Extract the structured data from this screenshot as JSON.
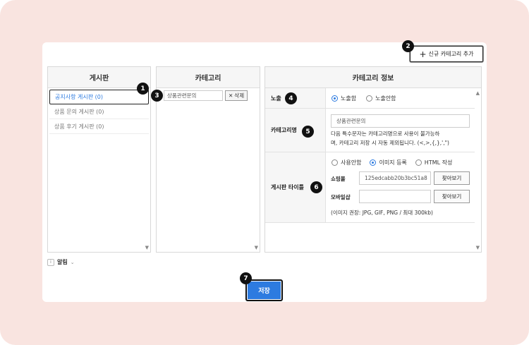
{
  "toolbar": {
    "add_category_label": "신규 카테고리 추가"
  },
  "board_panel": {
    "title": "게시판",
    "items": [
      {
        "label": "공지사항 게시판 (0)",
        "active": true
      },
      {
        "label": "상품 문의 게시판 (0)",
        "active": false
      },
      {
        "label": "상품 후기 게시판 (0)",
        "active": false
      }
    ]
  },
  "category_panel": {
    "title": "카테고리",
    "item": {
      "name": "상품관련문의",
      "delete_label": "삭제"
    }
  },
  "info_panel": {
    "title": "카테고리 정보",
    "exposure": {
      "label": "노출",
      "options": [
        {
          "label": "노출함",
          "checked": true
        },
        {
          "label": "노출안함",
          "checked": false
        }
      ]
    },
    "category_name": {
      "label": "카테고리명",
      "value": "상품관련문의",
      "note_line1": "다음 특수문자는 카테고리명으로 사용이 불가능하",
      "note_line2": "며, 카테고리 저장 시 자동 제외됩니다. (<,>,{,},',\")"
    },
    "board_title": {
      "label": "게시판 타이틀",
      "options": [
        {
          "label": "사용안함",
          "checked": false
        },
        {
          "label": "이미지 등록",
          "checked": true
        },
        {
          "label": "HTML 작성",
          "checked": false
        }
      ],
      "shop_label": "쇼핑몰",
      "shop_value": "125edcabb20b3bc51a8",
      "mobile_label": "모바일샵",
      "mobile_value": "",
      "find_label": "찾아보기",
      "image_note": "(이미지 권장: JPG, GIF, PNG / 최대 300kb)"
    }
  },
  "help": {
    "icon_text": "i",
    "label": "알림"
  },
  "footer": {
    "save_label": "저장"
  },
  "badges": [
    "1",
    "2",
    "3",
    "4",
    "5",
    "6",
    "7"
  ],
  "colors": {
    "accent": "#2d7be0",
    "background": "#f9e4e0"
  }
}
